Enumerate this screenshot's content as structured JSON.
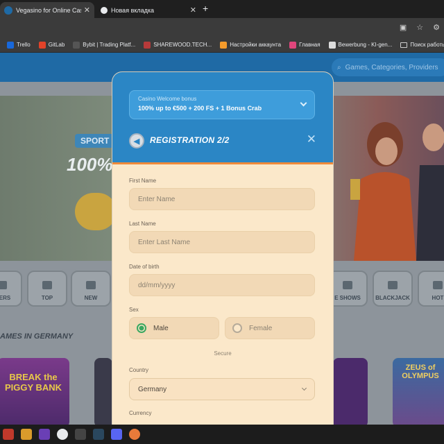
{
  "browser": {
    "tabs": [
      {
        "title": "Vegasino for Online Casino and",
        "active": true,
        "close": "✕"
      },
      {
        "title": "Новая вкладка",
        "active": false,
        "close": "✕"
      }
    ],
    "new_tab": "+",
    "address_left": "/",
    "bookmarks": [
      {
        "label": "Trello",
        "icon": "trello-icon",
        "color": "#1868db"
      },
      {
        "label": "GitLab",
        "icon": "gitlab-icon",
        "color": "#e24329"
      },
      {
        "label": "Bybit | Trading Platf...",
        "icon": "bybit-icon",
        "color": "#222222"
      },
      {
        "label": "SHAREWOOD.TECH...",
        "icon": "sharewood-icon",
        "color": "#b73a3a"
      },
      {
        "label": "Настройки аккаунта",
        "icon": "account-settings-icon",
        "color": "#f59b2b"
      },
      {
        "label": "Главная",
        "icon": "home-site-icon",
        "color": "#e0467c"
      },
      {
        "label": "Bewerbung - KI-gen...",
        "icon": "bewerbung-icon",
        "color": "#dcdcdc"
      },
      {
        "label": "Поиск работы",
        "icon": "folder-icon",
        "color": ""
      }
    ]
  },
  "site": {
    "search_placeholder": "Games, Categories, Providers",
    "banner": {
      "tag": "SPORT",
      "headline": "100%"
    },
    "categories": [
      "IDERS",
      "TOP",
      "NEW",
      "E SHOWS",
      "BLACKJACK",
      "HOT"
    ],
    "section_title": "AMES IN GERMANY",
    "games": [
      "BREAK the PIGGY BANK",
      "ZEUS of OLYMPUS"
    ]
  },
  "modal": {
    "bonus": {
      "label": "Casino Welcome bonus",
      "offer": "100% up to €500 + 200 FS + 1 Bonus Crab"
    },
    "title": "REGISTRATION 2/2",
    "fields": {
      "first_name": {
        "label": "First Name",
        "placeholder": "Enter Name"
      },
      "last_name": {
        "label": "Last Name",
        "placeholder": "Enter Last Name"
      },
      "dob": {
        "label": "Date of birth",
        "placeholder": "dd/mm/yyyy"
      },
      "sex": {
        "label": "Sex",
        "options": [
          "Male",
          "Female"
        ],
        "selected": "Male"
      },
      "secure": "Secure",
      "country": {
        "label": "Country",
        "value": "Germany"
      },
      "currency": {
        "label": "Currency"
      }
    },
    "accent": "#2b86c5",
    "form_bg": "#fbe8ca"
  },
  "colors": {
    "header_blue": "#1f6aa5",
    "orange_bar": "#f08a3a",
    "male_selected": "#38a760"
  }
}
